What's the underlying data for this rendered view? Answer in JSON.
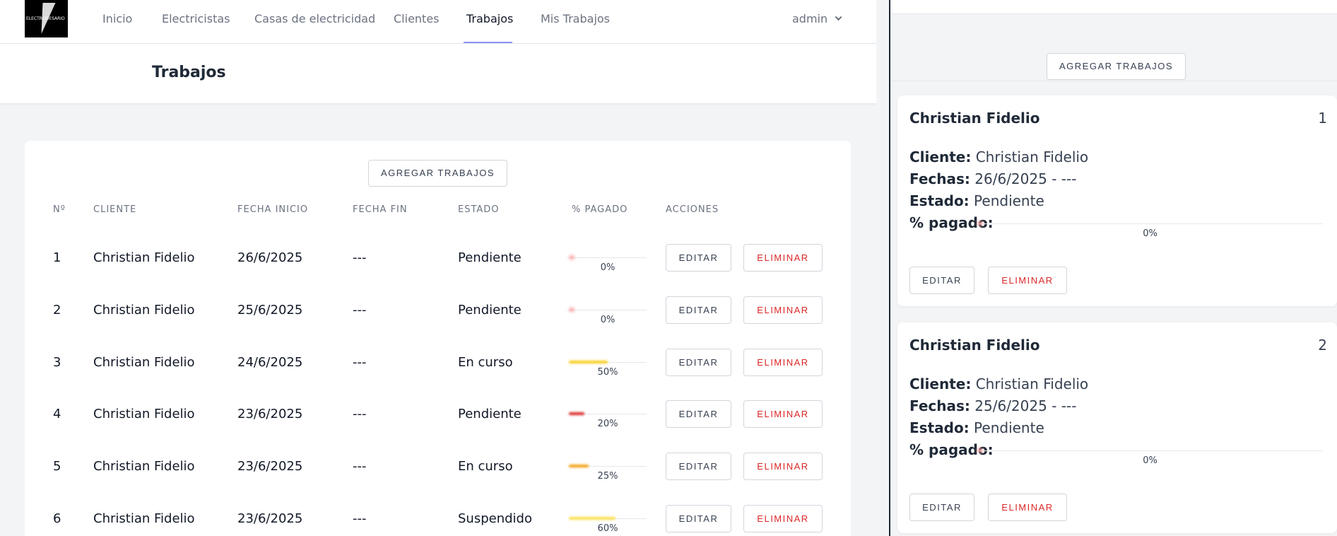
{
  "logo": {
    "text": "ELECTRODESARIO"
  },
  "nav": {
    "items": [
      "Inicio",
      "Electricistas",
      "Casas de electricidad",
      "Clientes",
      "Trabajos",
      "Mis Trabajos"
    ],
    "active": "Trabajos",
    "user": "admin"
  },
  "page": {
    "title": "Trabajos"
  },
  "add_button": "AGREGAR TRABAJOS",
  "table": {
    "headers": [
      "Nº",
      "CLIENTE",
      "FECHA INICIO",
      "FECHA FIN",
      "ESTADO",
      "% PAGADO",
      "ACCIONES"
    ],
    "edit_label": "EDITAR",
    "delete_label": "ELIMINAR",
    "rows": [
      {
        "num": "1",
        "cliente": "Christian Fidelio",
        "inicio": "26/6/2025",
        "fin": "---",
        "estado": "Pendiente",
        "pagado": 0,
        "pagado_label": "0%",
        "color": "#f87171"
      },
      {
        "num": "2",
        "cliente": "Christian Fidelio",
        "inicio": "25/6/2025",
        "fin": "---",
        "estado": "Pendiente",
        "pagado": 0,
        "pagado_label": "0%",
        "color": "#f87171"
      },
      {
        "num": "3",
        "cliente": "Christian Fidelio",
        "inicio": "24/6/2025",
        "fin": "---",
        "estado": "En curso",
        "pagado": 50,
        "pagado_label": "50%",
        "color": "#facc15"
      },
      {
        "num": "4",
        "cliente": "Christian Fidelio",
        "inicio": "23/6/2025",
        "fin": "---",
        "estado": "Pendiente",
        "pagado": 20,
        "pagado_label": "20%",
        "color": "#dc2626"
      },
      {
        "num": "5",
        "cliente": "Christian Fidelio",
        "inicio": "23/6/2025",
        "fin": "---",
        "estado": "En curso",
        "pagado": 25,
        "pagado_label": "25%",
        "color": "#f59e0b"
      },
      {
        "num": "6",
        "cliente": "Christian Fidelio",
        "inicio": "23/6/2025",
        "fin": "---",
        "estado": "Suspendido",
        "pagado": 60,
        "pagado_label": "60%",
        "color": "#fde047"
      }
    ]
  },
  "mobile": {
    "labels": {
      "cliente": "Cliente:",
      "fechas": "Fechas:",
      "estado": "Estado:",
      "pagado": "% pagado:"
    },
    "cards": [
      {
        "title": "Christian Fidelio",
        "num": "1",
        "cliente": "Christian Fidelio",
        "fechas": "26/6/2025 - ---",
        "estado": "Pendiente",
        "pagado": 0,
        "pagado_label": "0%"
      },
      {
        "title": "Christian Fidelio",
        "num": "2",
        "cliente": "Christian Fidelio",
        "fechas": "25/6/2025 - ---",
        "estado": "Pendiente",
        "pagado": 0,
        "pagado_label": "0%"
      }
    ]
  }
}
